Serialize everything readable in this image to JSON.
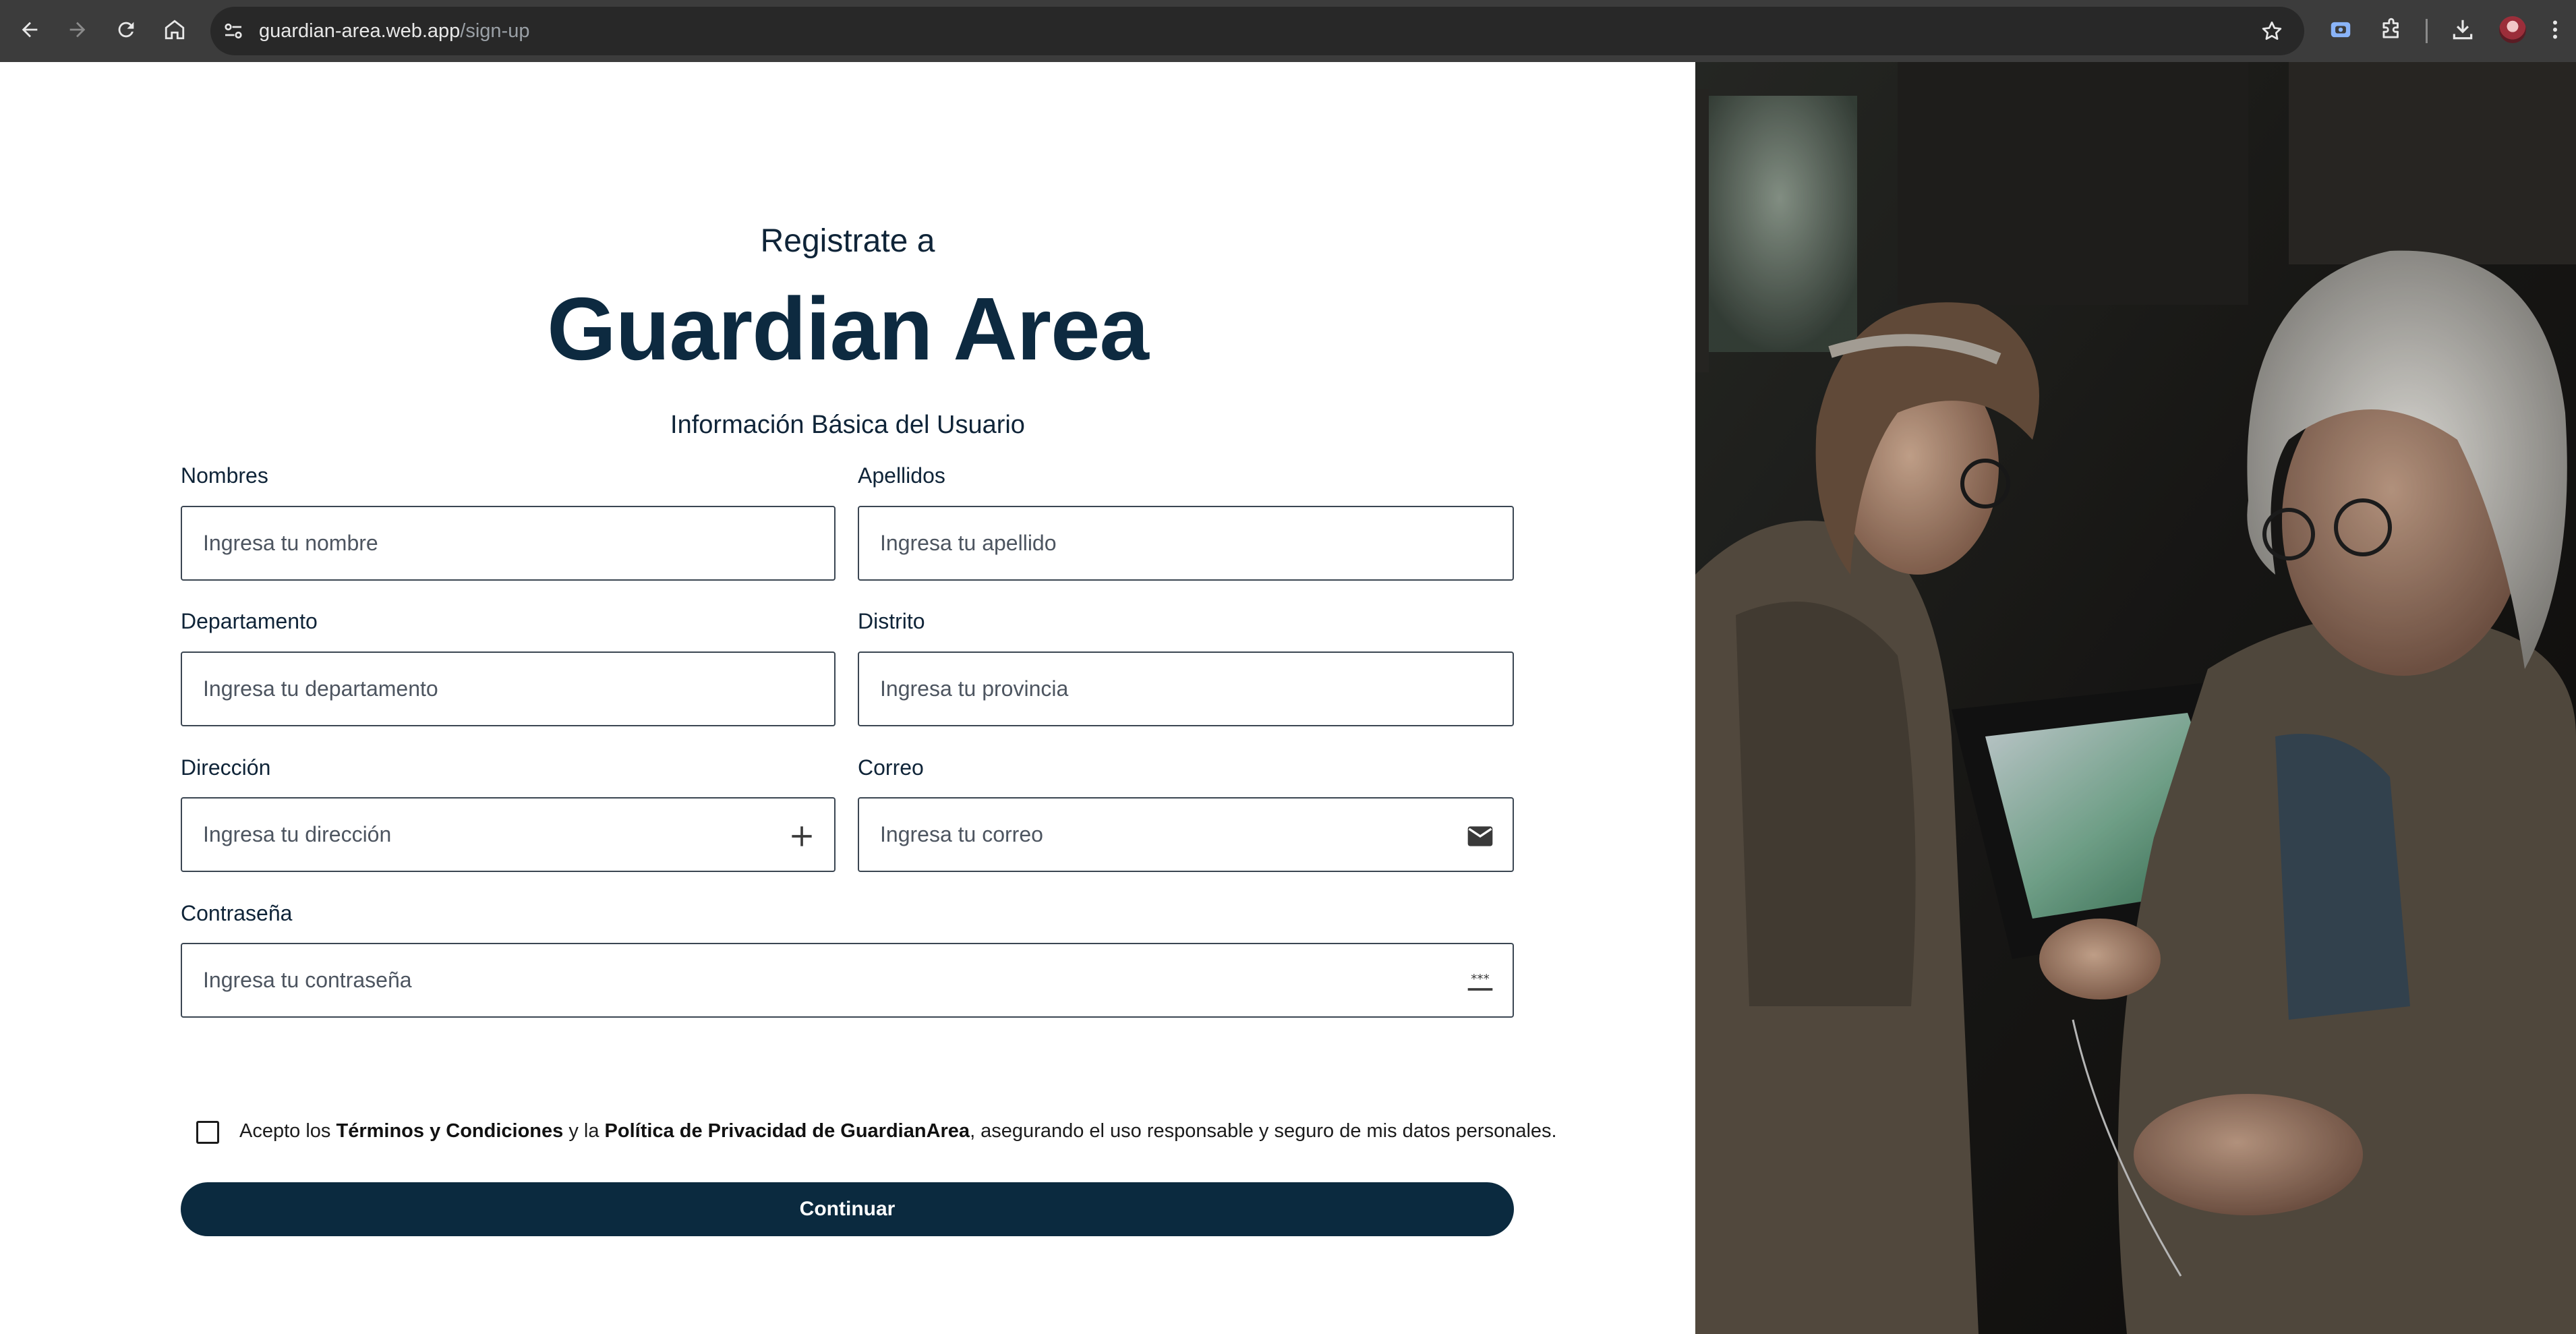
{
  "browser": {
    "url_host": "guardian-area.web.app",
    "url_path": "/sign-up"
  },
  "page": {
    "subtitle": "Registrate a",
    "brand": "Guardian Area",
    "section_title": "Información Básica del Usuario"
  },
  "form": {
    "nombres": {
      "label": "Nombres",
      "placeholder": "Ingresa tu nombre"
    },
    "apellidos": {
      "label": "Apellidos",
      "placeholder": "Ingresa tu apellido"
    },
    "departamento": {
      "label": "Departamento",
      "placeholder": "Ingresa tu departamento"
    },
    "distrito": {
      "label": "Distrito",
      "placeholder": "Ingresa tu provincia"
    },
    "direccion": {
      "label": "Dirección",
      "placeholder": "Ingresa tu dirección",
      "icon": "plus-icon"
    },
    "correo": {
      "label": "Correo",
      "placeholder": "Ingresa tu correo",
      "icon": "mail-icon"
    },
    "contrasena": {
      "label": "Contraseña",
      "placeholder": "Ingresa tu contraseña",
      "icon": "password-dots-icon"
    },
    "terms": {
      "prefix": "Acepto los ",
      "terms_link": "Términos y Condiciones",
      "middle": " y la ",
      "privacy_link": "Política de Privacidad de GuardianArea",
      "suffix": ", asegurando el uso responsable y seguro de mis datos personales.",
      "checked": false
    },
    "submit_label": "Continuar"
  },
  "colors": {
    "brand_dark": "#0b2a3f",
    "browser_bar": "#3c3c3c"
  }
}
